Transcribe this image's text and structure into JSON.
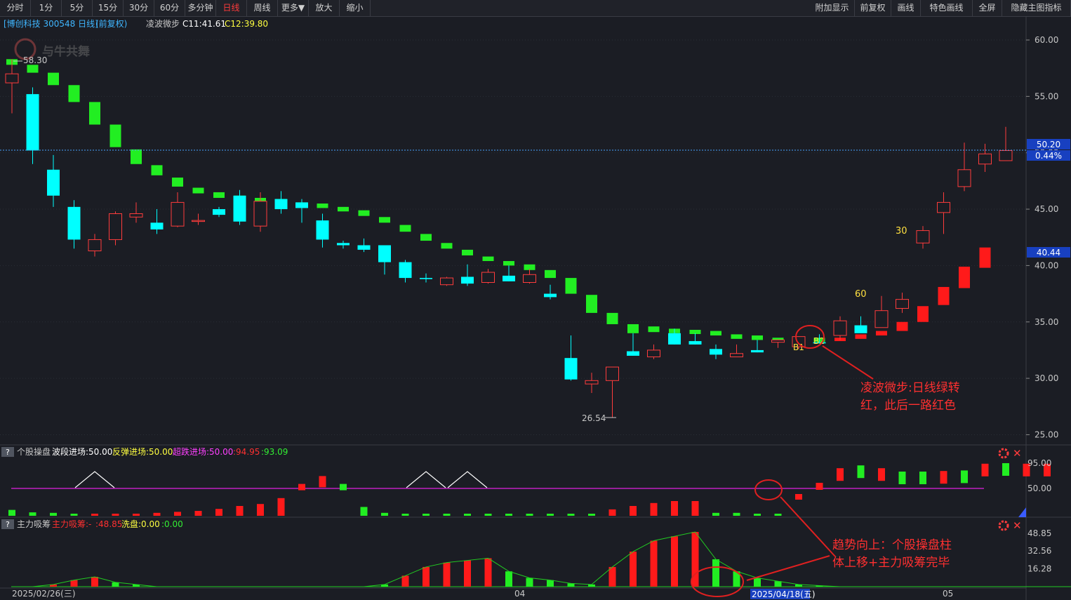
{
  "toolbar": {
    "left": [
      "分时",
      "1分",
      "5分",
      "15分",
      "30分",
      "60分",
      "多分钟",
      "日线",
      "周线",
      "更多▼",
      "放大",
      "缩小"
    ],
    "active": "日线",
    "right": [
      "附加显示",
      "前复权",
      "画线",
      "特色画线",
      "全屏",
      "隐藏主图指标"
    ]
  },
  "main_header": {
    "stock": "[博创科技 300548 日线]",
    "adj": "(前复权)",
    "indicator": "凌波微步",
    "c1": "C11:41.61",
    "c2": "C12:39.80"
  },
  "watermark": "与牛共舞",
  "price_badges": {
    "last": "50.20",
    "pct": "0.44%",
    "level": "40.44"
  },
  "annotations": {
    "high": "58.30",
    "low": "26.54",
    "b1": "B1",
    "b2": "B2",
    "n60": "60",
    "n30": "30",
    "note1_line1": "凌波微步:日线绿转",
    "note1_line2": "红，此后一路红色",
    "note2_line1": "趋势向上：个股操盘柱",
    "note2_line2": "体上移+主力吸筹完毕"
  },
  "sub1_header": {
    "name": "个股操盘",
    "a": "波段进场:50.00",
    "b": "反弹进场:50.00",
    "c": "超跌进场:50.00",
    "d": ":94.95",
    "e": ":93.09"
  },
  "sub2_header": {
    "name": "主力吸筹",
    "a": "主力吸筹:-",
    "b": ":48.85",
    "c": "洗盘:0.00",
    "d": ":0.00"
  },
  "x_labels": {
    "start": "2025/02/26(三)",
    "m1": "04",
    "cursor": "2025/04/18(五)",
    "m2": "05"
  },
  "colors": {
    "up": "#ff3c3c",
    "down": "#00ffff",
    "lbGreen": "#22ee22",
    "lbRed": "#ff1a1a",
    "bg": "#1b1d24"
  },
  "chart_data": [
    {
      "type": "candlestick",
      "title": "博创科技 300548 日线",
      "ylim": [
        25,
        62
      ],
      "yticks": [
        60,
        55,
        50,
        45,
        40,
        35,
        30,
        25
      ],
      "ohlc": [
        [
          56.2,
          58.3,
          53.5,
          57.0
        ],
        [
          55.2,
          55.8,
          49.0,
          50.2
        ],
        [
          48.5,
          49.8,
          45.2,
          46.2
        ],
        [
          45.2,
          45.8,
          41.5,
          42.3
        ],
        [
          41.3,
          42.8,
          40.8,
          42.3
        ],
        [
          42.3,
          44.8,
          41.8,
          44.6
        ],
        [
          44.3,
          45.6,
          43.8,
          44.6
        ],
        [
          43.8,
          45.0,
          42.8,
          43.2
        ],
        [
          43.5,
          46.5,
          43.4,
          45.6
        ],
        [
          44.0,
          44.6,
          43.6,
          44.0
        ],
        [
          45.0,
          45.2,
          44.3,
          44.5
        ],
        [
          46.2,
          46.7,
          43.6,
          43.9
        ],
        [
          43.5,
          46.5,
          43.0,
          45.7
        ],
        [
          45.9,
          46.6,
          44.6,
          45.0
        ],
        [
          45.6,
          45.9,
          43.8,
          45.1
        ],
        [
          44.0,
          44.6,
          41.6,
          42.3
        ],
        [
          42.0,
          42.2,
          41.5,
          41.8
        ],
        [
          41.8,
          42.4,
          41.2,
          41.4
        ],
        [
          41.8,
          41.8,
          39.2,
          40.3
        ],
        [
          40.3,
          40.5,
          38.5,
          38.9
        ],
        [
          38.9,
          39.3,
          38.5,
          38.8
        ],
        [
          38.3,
          39.0,
          38.2,
          38.9
        ],
        [
          39.0,
          40.1,
          38.2,
          38.4
        ],
        [
          38.5,
          39.7,
          38.4,
          39.4
        ],
        [
          39.1,
          40.0,
          38.6,
          38.6
        ],
        [
          38.5,
          39.7,
          38.4,
          39.2
        ],
        [
          37.5,
          38.3,
          37.0,
          37.2
        ],
        [
          31.8,
          33.8,
          29.8,
          29.9
        ],
        [
          29.5,
          30.5,
          28.7,
          29.8
        ],
        [
          29.8,
          30.7,
          26.54,
          31.0
        ],
        [
          32.4,
          34.0,
          32.0,
          32.0
        ],
        [
          31.9,
          33.0,
          31.7,
          32.5
        ],
        [
          34.0,
          34.4,
          33.0,
          33.0
        ],
        [
          33.3,
          34.0,
          33.0,
          33.0
        ],
        [
          32.6,
          33.0,
          31.7,
          32.1
        ],
        [
          31.9,
          33.0,
          31.9,
          32.2
        ],
        [
          32.5,
          33.4,
          32.3,
          32.3
        ],
        [
          33.2,
          33.3,
          32.7,
          33.4
        ],
        [
          32.8,
          33.4,
          32.6,
          33.7
        ],
        [
          33.2,
          33.9,
          33.1,
          33.1
        ],
        [
          33.8,
          35.5,
          33.4,
          35.1
        ],
        [
          34.7,
          35.5,
          34.5,
          34.0
        ],
        [
          34.5,
          37.3,
          34.5,
          36.0
        ],
        [
          36.2,
          37.6,
          35.8,
          37.0
        ],
        [
          42.0,
          43.5,
          41.5,
          43.1
        ],
        [
          44.7,
          46.5,
          42.8,
          45.6
        ],
        [
          47.0,
          50.9,
          46.6,
          48.5
        ],
        [
          49.0,
          50.8,
          48.3,
          49.9
        ],
        [
          49.3,
          52.3,
          49.3,
          50.2
        ]
      ],
      "lbwb_green": [
        [
          57.8,
          58.3
        ],
        [
          57.1,
          57.8
        ],
        [
          56.0,
          57.1
        ],
        [
          54.5,
          56.0
        ],
        [
          52.5,
          54.5
        ],
        [
          50.5,
          52.5
        ],
        [
          49.0,
          50.3
        ],
        [
          48.0,
          48.9
        ],
        [
          47.0,
          47.8
        ],
        [
          46.4,
          46.9
        ],
        [
          46.0,
          46.5
        ],
        [
          45.6,
          46.2
        ],
        [
          45.5,
          46.0
        ],
        [
          45.3,
          45.9
        ],
        [
          45.2,
          45.6
        ],
        [
          45.1,
          45.5
        ],
        [
          44.8,
          45.2
        ],
        [
          44.4,
          44.9
        ],
        [
          43.8,
          44.3
        ],
        [
          43.0,
          43.6
        ],
        [
          42.2,
          42.8
        ],
        [
          41.5,
          42.0
        ],
        [
          40.9,
          41.4
        ],
        [
          40.4,
          40.8
        ],
        [
          40.0,
          40.4
        ],
        [
          39.6,
          40.1
        ],
        [
          38.9,
          39.6
        ],
        [
          37.5,
          38.9
        ],
        [
          35.8,
          37.4
        ],
        [
          34.8,
          35.8
        ],
        [
          34.0,
          34.8
        ],
        [
          34.1,
          34.6
        ],
        [
          34.0,
          34.4
        ],
        [
          34.0,
          34.3
        ],
        [
          33.8,
          34.2
        ],
        [
          33.5,
          33.9
        ],
        [
          33.4,
          33.8
        ],
        [
          33.3,
          33.6
        ],
        [
          33.3,
          33.6
        ],
        [
          33.3,
          33.6
        ]
      ],
      "lbwb_red": [
        [
          33.3,
          33.6
        ],
        [
          33.5,
          33.9
        ],
        [
          33.8,
          34.2
        ],
        [
          34.2,
          35.0
        ],
        [
          35.0,
          36.4
        ],
        [
          36.5,
          38.1
        ],
        [
          38.0,
          39.9
        ],
        [
          39.8,
          41.6
        ]
      ],
      "annotated_values": {
        "high": 58.3,
        "low": 26.54,
        "last": 50.2,
        "pct": 0.44,
        "level": 40.44
      }
    },
    {
      "type": "bar",
      "title": "个股操盘",
      "ylim": [
        0,
        100
      ],
      "yticks": [
        95,
        50
      ],
      "reference_line": 50,
      "values": [
        -12,
        -7,
        -6,
        -3,
        2,
        0,
        3,
        6,
        8,
        10,
        14,
        20,
        24,
        36,
        58,
        72,
        58,
        -18,
        -6,
        -3,
        -3,
        -3,
        -3,
        -3,
        -3,
        -3,
        -4,
        -4,
        -3,
        13,
        20,
        26,
        30,
        30,
        -6,
        -6,
        -4,
        -3,
        40,
        60,
        86,
        91,
        86,
        80,
        80,
        81,
        82,
        94,
        95,
        94,
        94
      ],
      "triangles_at": [
        4,
        20,
        22
      ]
    },
    {
      "type": "bar",
      "title": "主力吸筹",
      "yticks": [
        48.85,
        32.56,
        16.28
      ],
      "ylim": [
        0,
        55
      ],
      "values": [
        0,
        0,
        2,
        6,
        9,
        -4,
        -2,
        0,
        0,
        0,
        0,
        0,
        0,
        0,
        0,
        0,
        0,
        0,
        -2,
        10,
        18,
        22,
        24,
        26,
        -14,
        -8,
        -6,
        -3,
        -2,
        18,
        32,
        42,
        46,
        50,
        -25,
        -14,
        -8,
        -5,
        -2,
        -1,
        0,
        0,
        0,
        0,
        0,
        0,
        0,
        0,
        0,
        0,
        0,
        0,
        0
      ]
    }
  ]
}
